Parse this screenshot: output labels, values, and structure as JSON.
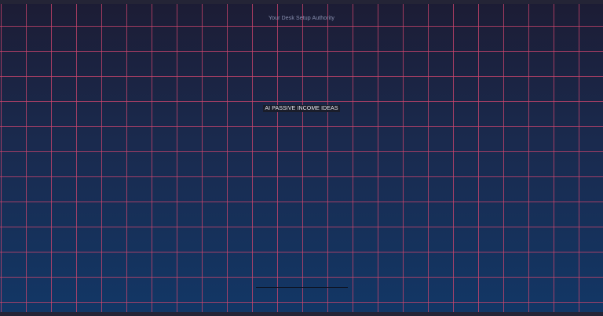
{
  "header": {
    "tagline": "Your Desk Setup Authority"
  },
  "hero": {
    "headline": "AI PASSIVE INCOME IDEAS"
  },
  "colors": {
    "grid_line": "#d0456e",
    "background_top": "#1c1c34",
    "background_bottom": "#123766",
    "frame": "#242436"
  }
}
